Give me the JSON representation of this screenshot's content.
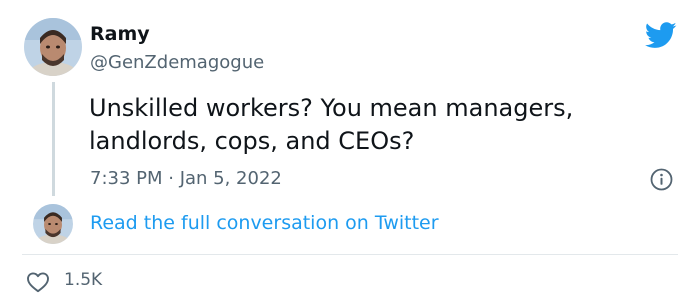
{
  "user": {
    "display_name": "Ramy",
    "handle": "@GenZdemagogue"
  },
  "tweet": {
    "text": "Unskilled workers? You mean managers, landlords, cops, and CEOs?",
    "timestamp": "7:33 PM · Jan 5, 2022"
  },
  "conversation": {
    "link_label": "Read the full conversation on Twitter"
  },
  "engagement": {
    "likes": "1.5K"
  },
  "icons": {
    "brand": "twitter-bird-icon",
    "info": "info-icon",
    "like": "heart-icon"
  },
  "colors": {
    "brand_blue": "#1d9bf0",
    "text_primary": "#0f1419",
    "text_secondary": "#536471",
    "thread_line": "#cfd9de"
  }
}
